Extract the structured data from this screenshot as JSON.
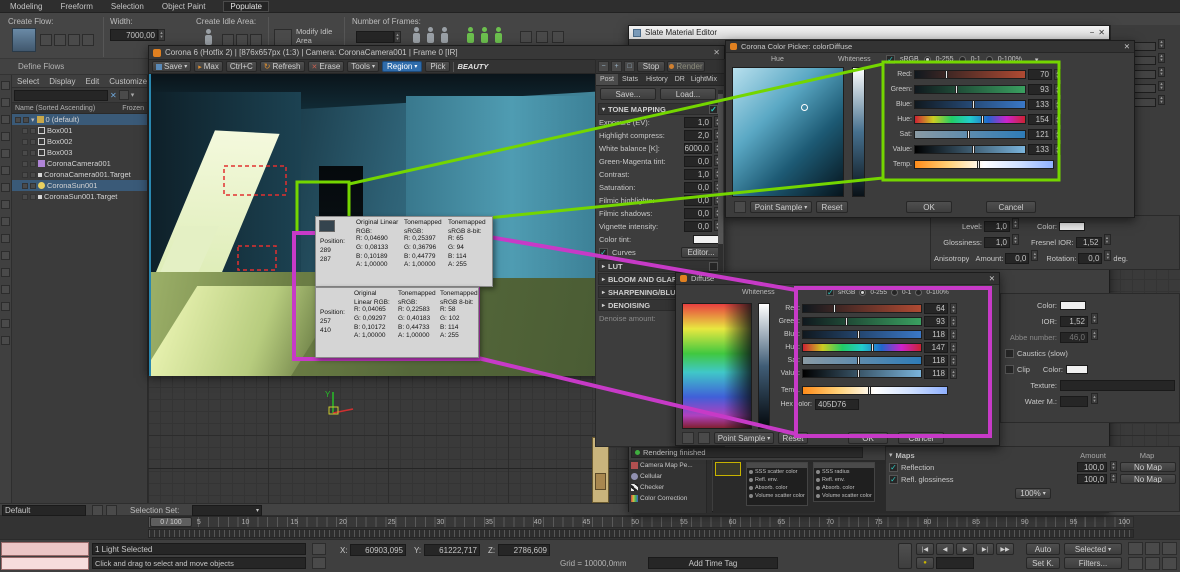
{
  "icons": {
    "close": "✕",
    "caret_down": "▾",
    "caret_right": "▸",
    "arrow_down": "▼",
    "check": "✓",
    "refresh": "↻",
    "minus": "−",
    "plus": "+",
    "box": "□",
    "play": "▶",
    "rew": "|◀",
    "fwd": "▶|",
    "ffwd": "▶▶",
    "back": "◀",
    "dot": "●",
    "search_x": "✕"
  },
  "colors": {
    "annotation_green": "#74d600",
    "annotation_magenta": "#c73ac7",
    "annotation_red": "#e23030",
    "hex_swatch": "#405D76"
  },
  "menubar": {
    "tabs": [
      "Modeling",
      "Freeform",
      "Selection",
      "Object Paint",
      "Populate"
    ]
  },
  "ribbon": {
    "create_flow": "Create Flow:",
    "width_label": "Width:",
    "width_value": "7000,00",
    "create_idle": "Create Idle Area:",
    "modify_idle": "Modify Idle Area",
    "num_frames": "Number of Frames:",
    "define_flows": "Define Flows"
  },
  "explorer": {
    "menu": [
      "Select",
      "Display",
      "Edit",
      "Customize"
    ],
    "header": "Name (Sorted Ascending)",
    "frozen": "Frozen",
    "items": [
      {
        "label": "0 (default)"
      },
      {
        "label": "Box001"
      },
      {
        "label": "Box002"
      },
      {
        "label": "Box003"
      },
      {
        "label": "CoronaCamera001"
      },
      {
        "label": "CoronaCamera001.Target"
      },
      {
        "label": "CoronaSun001"
      },
      {
        "label": "CoronaSun001.Target"
      }
    ]
  },
  "vfb": {
    "title": "Corona 6 (Hotfix 2) | [876x657px (1:3) | Camera: CoronaCamera001 | Frame 0 [IR]",
    "buttons": {
      "save": "Save",
      "max": "Max",
      "copy": "Ctrl+C",
      "refresh": "Refresh",
      "erase": "Erase",
      "tools": "Tools",
      "region": "Region",
      "pick": "Pick",
      "beauty": "BEAUTY"
    },
    "stop": "Stop",
    "render": "Render",
    "status": "Rendering finished"
  },
  "settings": {
    "tabs": [
      "Post",
      "Stats",
      "History",
      "DR",
      "LightMix"
    ],
    "save": "Save...",
    "load": "Load...",
    "tone_mapping": "TONE MAPPING",
    "fields": [
      {
        "label": "Exposure (EV):",
        "value": "1,0"
      },
      {
        "label": "Highlight compress:",
        "value": "2,0"
      },
      {
        "label": "White balance [K]:",
        "value": "6000,0"
      },
      {
        "label": "Green-Magenta tint:",
        "value": "0,0"
      },
      {
        "label": "Contrast:",
        "value": "1,0"
      },
      {
        "label": "Saturation:",
        "value": "0,0"
      },
      {
        "label": "Filmic highlights:",
        "value": "0,0"
      },
      {
        "label": "Filmic shadows:",
        "value": "0,0"
      },
      {
        "label": "Vignette intensity:",
        "value": "0,0"
      },
      {
        "label": "Color tint:",
        "value": ""
      }
    ],
    "curves": "Curves",
    "editor": "Editor...",
    "sections": [
      "LUT",
      "BLOOM AND GLARE",
      "SHARPENING/BLURRING",
      "DENOISING"
    ],
    "denoise": "Denoise amount:"
  },
  "slate": {
    "title": "Slate Material Editor",
    "zoom": "100%",
    "browser": [
      "Camera Map Pe...",
      "Cellular",
      "Checker",
      "Color Correction"
    ],
    "node1": [
      "SSS scatter color",
      "Refl. env.",
      "Absorb. color",
      "Volume scatter color"
    ],
    "node2": [
      "SSS radius",
      "Refl. env.",
      "Absorb. color",
      "Volume scatter color"
    ]
  },
  "picker_green": {
    "title": "Corona Color Picker: colorDiffuse",
    "hue": "Hue",
    "whiteness": "Whiteness",
    "srgb": "sRGB",
    "r255": "0-255",
    "r1": "0-1",
    "r100": "0-100%",
    "sliders": [
      {
        "label": "Red:",
        "value": "70"
      },
      {
        "label": "Green:",
        "value": "93"
      },
      {
        "label": "Blue:",
        "value": "133"
      },
      {
        "label": "Hue:",
        "value": "154"
      },
      {
        "label": "Sat:",
        "value": "121"
      },
      {
        "label": "Value:",
        "value": "133"
      }
    ],
    "temp": "Temp.",
    "point_sample": "Point Sample",
    "reset": "Reset",
    "ok": "OK",
    "cancel": "Cancel"
  },
  "picker_blue": {
    "title": "Diffuse",
    "whiteness": "Whiteness",
    "srgb": "sRGB",
    "r255": "0-255",
    "r1": "0-1",
    "r100": "0-100%",
    "sliders": [
      {
        "label": "Red:",
        "value": "64"
      },
      {
        "label": "Green:",
        "value": "93"
      },
      {
        "label": "Blue:",
        "value": "118"
      },
      {
        "label": "Hue:",
        "value": "147"
      },
      {
        "label": "Sat:",
        "value": "118"
      },
      {
        "label": "Value:",
        "value": "118"
      }
    ],
    "temp": "Temp.",
    "hex_label": "Hex color:",
    "hex": "405D76",
    "swatch_style": "background:#405D76",
    "point_sample": "Point Sample",
    "reset": "Reset",
    "ok": "OK",
    "cancel": "Cancel"
  },
  "tooltip1": {
    "pos_label": "Position:",
    "px": "289",
    "py": "287",
    "h1": "Original Linear RGB:",
    "h2": "Tonemapped sRGB:",
    "h3": "Tonemapped sRGB 8-bit:",
    "rows": [
      [
        "R: 0,04690",
        "R: 0,25397",
        "R: 65"
      ],
      [
        "G: 0,08133",
        "G: 0,36796",
        "G: 94"
      ],
      [
        "B: 0,10189",
        "B: 0,44779",
        "B: 114"
      ],
      [
        "A: 1,00000",
        "A: 1,00000",
        "A: 255"
      ]
    ]
  },
  "tooltip2": {
    "pos_label": "Position:",
    "px": "257",
    "py": "410",
    "h1": "Original Linear RGB:",
    "h2": "Tonemapped sRGB:",
    "h3": "Tonemapped sRGB 8-bit:",
    "rows": [
      [
        "R: 0,04065",
        "R: 0,22583",
        "R: 58"
      ],
      [
        "G: 0,09297",
        "G: 0,40183",
        "G: 102"
      ],
      [
        "B: 0,10172",
        "B: 0,44733",
        "B: 114"
      ],
      [
        "A: 1,00000",
        "A: 1,00000",
        "A: 255"
      ]
    ]
  },
  "props": {
    "level": "Level:",
    "level_v": "1,0",
    "gloss": "Glossiness:",
    "gloss_v": "1,0",
    "fresnel": "Fresnel IOR:",
    "fresnel_v": "1,52",
    "aniso": "Anisotropy",
    "amount": "Amount:",
    "amount_v": "0,0",
    "rotation": "Rotation:",
    "rotation_v": "0,0",
    "deg": "deg.",
    "color": "Color:",
    "ior": "IOR:",
    "ior_v": "1,52",
    "abbe": "Abbe number:",
    "abbe_v": "46,0",
    "caustics": "Caustics (slow)",
    "clip": "Clip",
    "texture": "Texture:",
    "water": "Water M.:",
    "maps": "Maps",
    "amount_col": "Amount",
    "map_col": "Map",
    "rows": [
      {
        "name": "Reflection",
        "amount": "100,0",
        "map": "No Map"
      },
      {
        "name": "Refl. glossiness",
        "amount": "100,0",
        "map": "No Map"
      }
    ]
  },
  "timeline": {
    "handle": "0 / 100",
    "ticks": [
      "0",
      "5",
      "10",
      "15",
      "20",
      "25",
      "30",
      "35",
      "40",
      "45",
      "50",
      "55",
      "60",
      "65",
      "70",
      "75",
      "80",
      "85",
      "90",
      "95",
      "100"
    ]
  },
  "status": {
    "line1": "1 Light Selected",
    "line2": "Click and drag to select and move objects",
    "xl": "X:",
    "xv": "60903,095",
    "yl": "Y:",
    "yv": "61222,717",
    "zl": "Z:",
    "zv": "2786,609",
    "grid": "Grid = 10000,0mm",
    "time_tag": "Add Time Tag",
    "auto": "Auto",
    "selected": "Selected",
    "setk": "Set K.",
    "filters": "Filters...",
    "default": "Default",
    "selset": "Selection Set:"
  }
}
